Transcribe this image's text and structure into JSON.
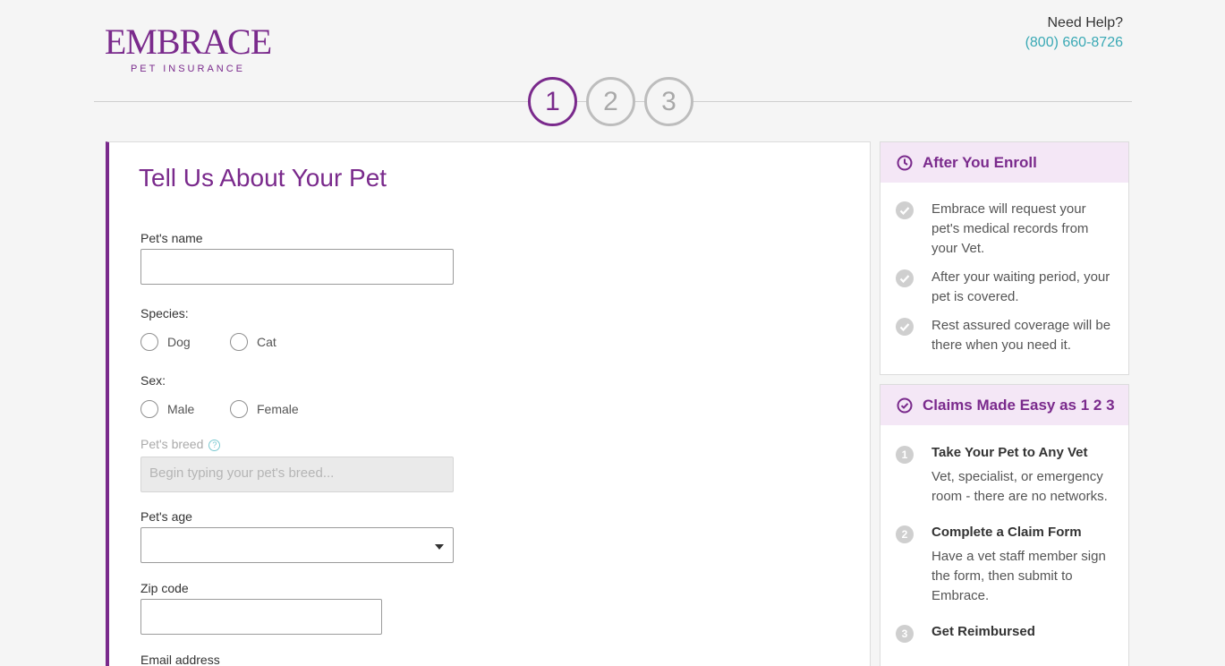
{
  "brand": {
    "name": "EMBRACE",
    "tagline": "PET INSURANCE",
    "color": "#7a2a8c"
  },
  "help": {
    "label": "Need Help?",
    "phone": "(800) 660-8726"
  },
  "steps": [
    "1",
    "2",
    "3"
  ],
  "active_step": 1,
  "form": {
    "title": "Tell Us About Your Pet",
    "pet_name": {
      "label": "Pet's name",
      "value": ""
    },
    "species": {
      "label": "Species:",
      "options": [
        "Dog",
        "Cat"
      ]
    },
    "sex": {
      "label": "Sex:",
      "options": [
        "Male",
        "Female"
      ]
    },
    "breed": {
      "label": "Pet's breed",
      "placeholder": "Begin typing your pet's breed..."
    },
    "age": {
      "label": "Pet's age",
      "value": ""
    },
    "zip": {
      "label": "Zip code",
      "value": ""
    },
    "email": {
      "label": "Email address"
    }
  },
  "after_enroll": {
    "title": "After You Enroll",
    "items": [
      "Embrace will request your pet's medical records from your Vet.",
      "After your waiting period, your pet is covered.",
      "Rest assured coverage will be there when you need it."
    ]
  },
  "claims": {
    "title": "Claims Made Easy as 1 2 3",
    "items": [
      {
        "num": "1",
        "title": "Take Your Pet to Any Vet",
        "text": "Vet, specialist, or emergency room - there are no networks."
      },
      {
        "num": "2",
        "title": "Complete a Claim Form",
        "text": "Have a vet staff member sign the form, then submit to Embrace."
      },
      {
        "num": "3",
        "title": "Get Reimbursed",
        "text": ""
      }
    ]
  }
}
